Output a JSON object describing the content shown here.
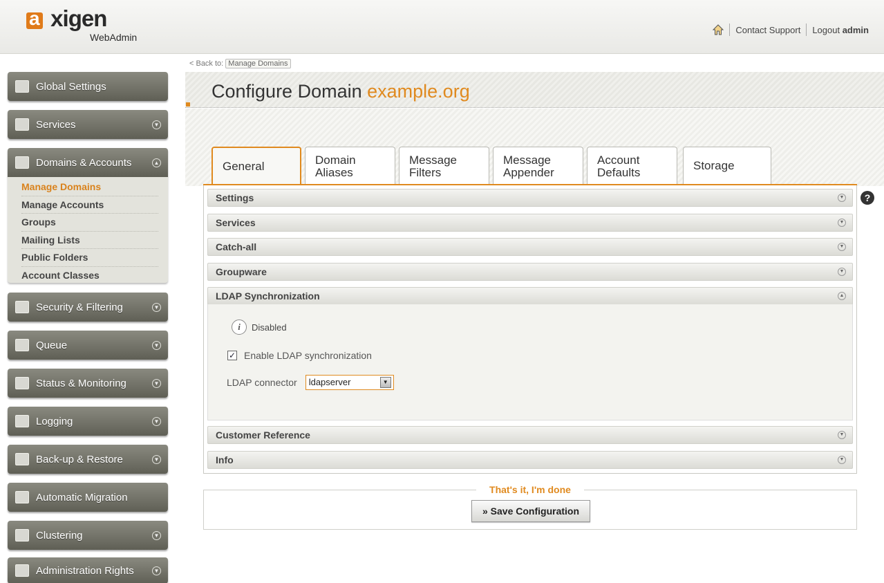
{
  "header": {
    "logo_text": "axigen",
    "logo_sub": "WebAdmin",
    "contact_support": "Contact Support",
    "logout": "Logout",
    "user": "admin"
  },
  "sidebar": {
    "items": [
      {
        "label": "Global Settings",
        "icon": "globe-icon"
      },
      {
        "label": "Services",
        "icon": "services-icon"
      },
      {
        "label": "Domains & Accounts",
        "icon": "domains-icon"
      },
      {
        "label": "Security & Filtering",
        "icon": "security-icon"
      },
      {
        "label": "Queue",
        "icon": "queue-icon"
      },
      {
        "label": "Status & Monitoring",
        "icon": "monitor-icon"
      },
      {
        "label": "Logging",
        "icon": "logging-icon"
      },
      {
        "label": "Back-up & Restore",
        "icon": "backup-icon"
      },
      {
        "label": "Automatic Migration",
        "icon": "migration-icon"
      },
      {
        "label": "Clustering",
        "icon": "cluster-icon"
      },
      {
        "label": "Administration Rights",
        "icon": "admin-icon"
      }
    ],
    "sub_items": [
      "Manage Domains",
      "Manage Accounts",
      "Groups",
      "Mailing Lists",
      "Public Folders",
      "Account Classes"
    ],
    "active_sub": "Manage Domains"
  },
  "breadcrumb": {
    "back_to": "< Back to:",
    "target": "Manage Domains"
  },
  "page": {
    "title_prefix": "Configure Domain",
    "domain": "example.org"
  },
  "tabs": [
    {
      "label": "General",
      "active": true
    },
    {
      "label": "Domain Aliases"
    },
    {
      "label": "Message Filters"
    },
    {
      "label": "Message Appender"
    },
    {
      "label": "Account Defaults"
    },
    {
      "label": "Storage"
    }
  ],
  "sections": [
    "Settings",
    "Services",
    "Catch-all",
    "Groupware",
    "LDAP Synchronization",
    "Customer Reference",
    "Info"
  ],
  "ldap": {
    "status": "Disabled",
    "checkbox_label": "Enable LDAP synchronization",
    "checked": true,
    "connector_label": "LDAP connector",
    "connector_value": "ldapserver"
  },
  "footer": {
    "legend": "That's it, I'm done",
    "save_label": "» Save Configuration"
  },
  "colors": {
    "accent": "#e08a1f",
    "sidebar": "#6e6e64"
  }
}
